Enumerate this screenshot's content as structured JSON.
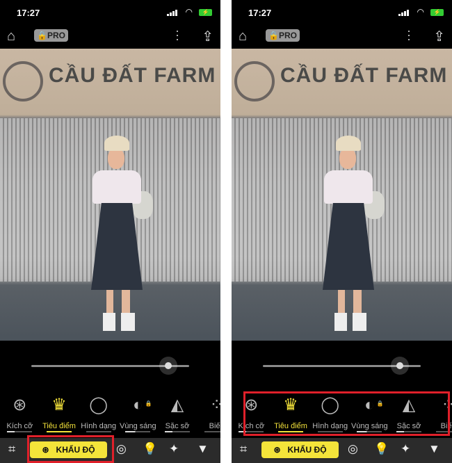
{
  "status": {
    "time": "17:27"
  },
  "topbar": {
    "pro_label": "PRO"
  },
  "photo": {
    "sign_text": "CẦU ĐẤT FARM"
  },
  "slider": {
    "value_percent": 87
  },
  "tools": [
    {
      "label": "Kích cỡ",
      "icon": "aperture-icon",
      "glyph": "⊛",
      "active": false,
      "locked": false,
      "level": 0.3
    },
    {
      "label": "Tiêu điểm",
      "icon": "tulip-icon",
      "glyph": "♛",
      "active": true,
      "locked": false,
      "level": 1
    },
    {
      "label": "Hình dạng",
      "icon": "ring-icon",
      "glyph": "◯",
      "active": false,
      "locked": false,
      "level": 0
    },
    {
      "label": "Vùng sáng",
      "icon": "highlight-icon",
      "glyph": "◐",
      "active": false,
      "locked": true,
      "level": 0.4
    },
    {
      "label": "Sặc sỡ",
      "icon": "paint-bucket-icon",
      "glyph": "◭",
      "active": false,
      "locked": false,
      "level": 0.3
    },
    {
      "label": "Biến",
      "icon": "bokeh-icon",
      "glyph": "⁘",
      "active": false,
      "locked": false,
      "level": 0
    }
  ],
  "bottom": {
    "aperture_label": "KHẨU ĐỘ"
  },
  "colors": {
    "accent": "#f4e43a",
    "highlight_box": "#e0202a"
  }
}
